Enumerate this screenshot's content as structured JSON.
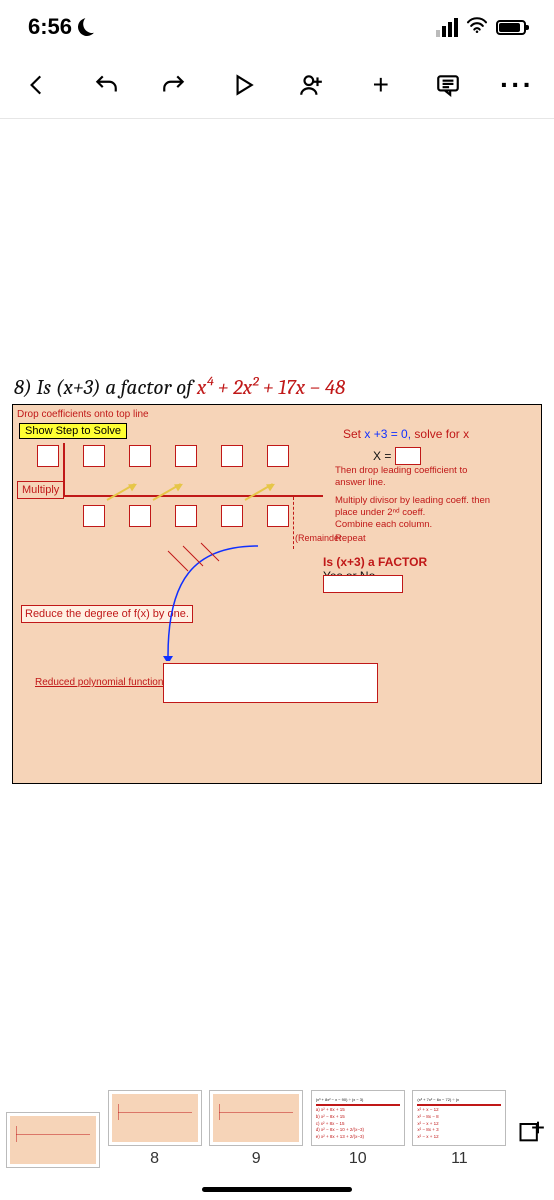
{
  "status": {
    "time": "6:56"
  },
  "problem": {
    "number": "8)",
    "prompt_prefix": "Is ",
    "binomial": "(x+3)",
    "prompt_mid": " a factor of  ",
    "polynomial_html": "x⁴ + 2x² + 17x − 48",
    "drop_instruction": "Drop coefficients onto top line",
    "show_step_label": "Show Step to Solve",
    "set_prefix": "Set ",
    "set_eq": "x +3 = 0,",
    "solve_for": " solve for x",
    "x_equals": "X =",
    "multiply_label": "Multiply",
    "note1": "Then drop leading coefficient to answer line.",
    "note2": "Multiply divisor by leading coeff. then place under 2ⁿᵈ coeff.",
    "note3": "Combine each column.",
    "note4": "Repeat",
    "remainder_label": "(Remainder",
    "is_factor_q": "Is (x+3) a FACTOR",
    "yes_or_no": "Yes or No",
    "reduce_label": "Reduce the degree of f(x) by one.",
    "rpf_label": "Reduced polynomial function"
  },
  "thumbs": {
    "n8": "8",
    "n9": "9",
    "n10": "10",
    "n11": "11",
    "list10": {
      "t": "(x³ + 8x² − x − 90) ÷ (x − 3)",
      "r1": "a)  x² + 8x + 15",
      "r2": "b)  x² − 8x + 15",
      "r3": "c)  x² + 8x − 15",
      "r4": "d)  x² − 8x − 10 + 2/(x−3)",
      "r5": "e)  x² + 8x + 13 + 2/(x−3)"
    },
    "list11": {
      "t": "(x³ + 7x² − 6x − 72) ÷ (x",
      "r1": "x² + x − 12",
      "r2": "x² − 8x − 8",
      "r3": "x² − x + 12",
      "r4": "x² − 8x + 3",
      "r5": "x² − x + 12"
    }
  }
}
